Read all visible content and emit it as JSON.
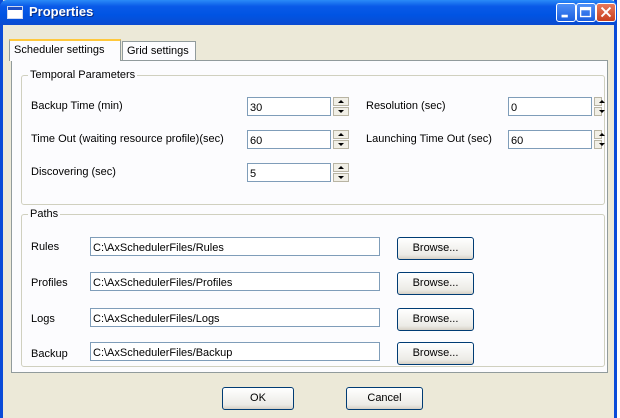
{
  "window": {
    "title": "Properties"
  },
  "tabs": [
    {
      "label": "Scheduler settings",
      "active": true
    },
    {
      "label": "Grid settings",
      "active": false
    }
  ],
  "temporal": {
    "title": "Temporal Parameters",
    "backup_time": {
      "label": "Backup Time (min)",
      "value": "30"
    },
    "time_out": {
      "label": "Time Out (waiting resource profile)(sec)",
      "value": "60"
    },
    "discovering": {
      "label": "Discovering (sec)",
      "value": "5"
    },
    "resolution": {
      "label": "Resolution (sec)",
      "value": "0"
    },
    "launching_time_out": {
      "label": "Launching Time Out (sec)",
      "value": "60"
    }
  },
  "paths": {
    "title": "Paths",
    "items": [
      {
        "label": "Rules",
        "value": "C:\\AxSchedulerFiles/Rules",
        "browse": "Browse..."
      },
      {
        "label": "Profiles",
        "value": "C:\\AxSchedulerFiles/Profiles",
        "browse": "Browse..."
      },
      {
        "label": "Logs",
        "value": "C:\\AxSchedulerFiles/Logs",
        "browse": "Browse..."
      },
      {
        "label": "Backup",
        "value": "C:\\AxSchedulerFiles/Backup",
        "browse": "Browse..."
      }
    ]
  },
  "buttons": {
    "ok": "OK",
    "cancel": "Cancel"
  },
  "colors": {
    "titlebar": "#0054e3",
    "window_border": "#0a4bd8",
    "dialog_bg": "#ece9d8",
    "panel_bg": "#fcfcfe",
    "close_button": "#c8401f"
  }
}
